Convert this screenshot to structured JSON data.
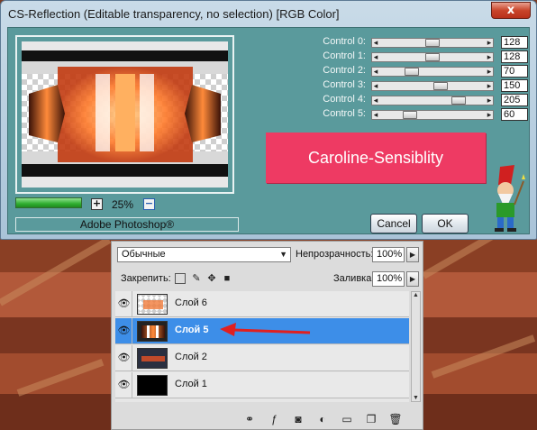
{
  "window": {
    "title": "CS-Reflection (Editable transparency, no selection) [RGB Color]",
    "close_label": "x"
  },
  "preview": {
    "zoom_minus": "−",
    "zoom_plus": "+",
    "zoom_value": "25%",
    "progress_level": 1.0,
    "credit": "Adobe Photoshop®"
  },
  "controls": [
    {
      "label": "Control 0:",
      "value": "128",
      "level": 0.5
    },
    {
      "label": "Control 1:",
      "value": "128",
      "level": 0.5
    },
    {
      "label": "Control 2:",
      "value": "70",
      "level": 0.27
    },
    {
      "label": "Control 3:",
      "value": "150",
      "level": 0.59
    },
    {
      "label": "Control 4:",
      "value": "205",
      "level": 0.8
    },
    {
      "label": "Control 5:",
      "value": "60",
      "level": 0.24
    }
  ],
  "watermark": "Caroline-Sensiblity",
  "buttons": {
    "cancel": "Cancel",
    "ok": "OK"
  },
  "layers_panel": {
    "blend_mode": "Обычные",
    "opacity_label": "Непрозрачность:",
    "opacity_value": "100%",
    "lock_label": "Закрепить:",
    "fill_label": "Заливка:",
    "fill_value": "100%",
    "layers": [
      {
        "name": "Слой 6",
        "selected": false
      },
      {
        "name": "Слой 5",
        "selected": true
      },
      {
        "name": "Слой 2",
        "selected": false
      },
      {
        "name": "Слой 1",
        "selected": false
      }
    ]
  },
  "colors": {
    "dialog_client": "#5a9a9c",
    "watermark_bg": "#ee3a63",
    "selection": "#3d8ee8",
    "arrow": "#e02020"
  }
}
